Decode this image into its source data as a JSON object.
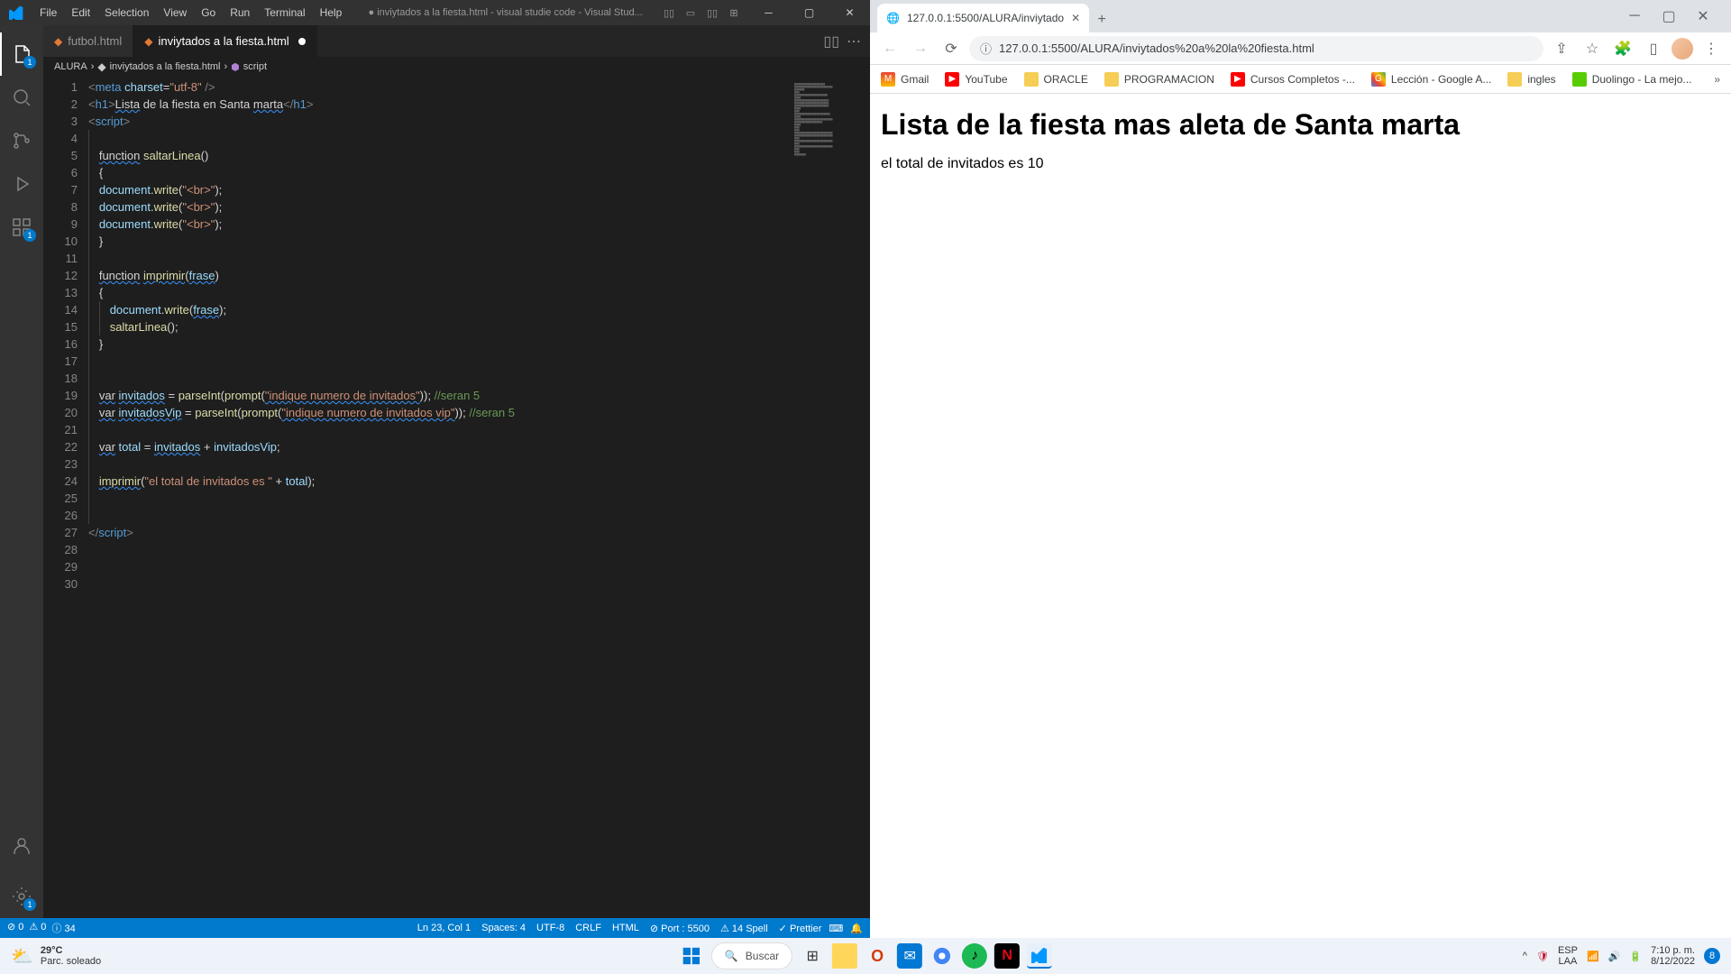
{
  "vscode": {
    "menus": [
      "File",
      "Edit",
      "Selection",
      "View",
      "Go",
      "Run",
      "Terminal",
      "Help"
    ],
    "title": "● inviytados a la fiesta.html - visual studie code - Visual Stud...",
    "tabs": [
      {
        "name": "futbol.html",
        "active": false,
        "dirty": false
      },
      {
        "name": "inviytados a la fiesta.html",
        "active": true,
        "dirty": true
      }
    ],
    "breadcrumb": {
      "folder": "ALURA",
      "file": "inviytados a la fiesta.html",
      "symbol": "script"
    },
    "lines": 30,
    "code": [
      {
        "n": 1,
        "t": [
          [
            "tag",
            "<"
          ],
          [
            "tagname",
            "meta"
          ],
          [
            "txt",
            " "
          ],
          [
            "attr",
            "charset"
          ],
          [
            "op",
            "="
          ],
          [
            "str",
            "\"utf-8\""
          ],
          [
            "txt",
            " "
          ],
          [
            "tag",
            "/>"
          ]
        ]
      },
      {
        "n": 2,
        "t": []
      },
      {
        "n": 3,
        "t": [
          [
            "tag",
            "<"
          ],
          [
            "tagname",
            "h1"
          ],
          [
            "tag",
            ">"
          ],
          [
            "txtw",
            "Lista"
          ],
          [
            "txt",
            " de la fiesta en Santa "
          ],
          [
            "txtw",
            "marta"
          ],
          [
            "tag",
            "</"
          ],
          [
            "tagname",
            "h1"
          ],
          [
            "tag",
            ">"
          ]
        ]
      },
      {
        "n": 4,
        "t": []
      },
      {
        "n": 5,
        "t": [
          [
            "tag",
            "<"
          ],
          [
            "tagname",
            "script"
          ],
          [
            "tag",
            ">"
          ]
        ]
      },
      {
        "n": 6,
        "t": [],
        "indent": 1
      },
      {
        "n": 7,
        "t": [
          [
            "kw",
            "function"
          ],
          [
            "txt",
            " "
          ],
          [
            "fn",
            "saltarLinea"
          ],
          [
            "punc",
            "()"
          ]
        ],
        "indent": 1
      },
      {
        "n": 8,
        "t": [
          [
            "punc",
            "{"
          ]
        ],
        "indent": 1
      },
      {
        "n": 9,
        "t": [
          [
            "var",
            "document"
          ],
          [
            "punc",
            "."
          ],
          [
            "fn",
            "write"
          ],
          [
            "punc",
            "("
          ],
          [
            "str",
            "\"<br>\""
          ],
          [
            "punc",
            ");"
          ]
        ],
        "indent": 1
      },
      {
        "n": 10,
        "t": [
          [
            "var",
            "document"
          ],
          [
            "punc",
            "."
          ],
          [
            "fn",
            "write"
          ],
          [
            "punc",
            "("
          ],
          [
            "str",
            "\"<br>\""
          ],
          [
            "punc",
            ");"
          ]
        ],
        "indent": 1
      },
      {
        "n": 11,
        "t": [
          [
            "var",
            "document"
          ],
          [
            "punc",
            "."
          ],
          [
            "fn",
            "write"
          ],
          [
            "punc",
            "("
          ],
          [
            "str",
            "\"<br>\""
          ],
          [
            "punc",
            ");"
          ]
        ],
        "indent": 1
      },
      {
        "n": 12,
        "t": [
          [
            "punc",
            "}"
          ]
        ],
        "indent": 1
      },
      {
        "n": 13,
        "t": [],
        "indent": 1
      },
      {
        "n": 14,
        "t": [
          [
            "kw",
            "function"
          ],
          [
            "txt",
            " "
          ],
          [
            "fnw",
            "imprimir"
          ],
          [
            "punc",
            "("
          ],
          [
            "varw",
            "frase"
          ],
          [
            "punc",
            ")"
          ]
        ],
        "indent": 1
      },
      {
        "n": 15,
        "t": [
          [
            "punc",
            "{"
          ]
        ],
        "indent": 1
      },
      {
        "n": 16,
        "t": [
          [
            "var",
            "document"
          ],
          [
            "punc",
            "."
          ],
          [
            "fn",
            "write"
          ],
          [
            "punc",
            "("
          ],
          [
            "varw",
            "frase"
          ],
          [
            "punc",
            ");"
          ]
        ],
        "indent": 2
      },
      {
        "n": 17,
        "t": [
          [
            "fn",
            "saltarLinea"
          ],
          [
            "punc",
            "();"
          ]
        ],
        "indent": 2
      },
      {
        "n": 18,
        "t": [
          [
            "punc",
            "}"
          ]
        ],
        "indent": 1
      },
      {
        "n": 19,
        "t": [],
        "indent": 1
      },
      {
        "n": 20,
        "t": [],
        "indent": 1
      },
      {
        "n": 21,
        "t": [
          [
            "kw",
            "var"
          ],
          [
            "txt",
            " "
          ],
          [
            "varw",
            "invitados"
          ],
          [
            "txt",
            " "
          ],
          [
            "op",
            "="
          ],
          [
            "txt",
            " "
          ],
          [
            "fn",
            "parseInt"
          ],
          [
            "punc",
            "("
          ],
          [
            "fn",
            "prompt"
          ],
          [
            "punc",
            "("
          ],
          [
            "strw",
            "\"indique numero de invitados\""
          ],
          [
            "punc",
            ")); "
          ],
          [
            "cm",
            "//seran 5"
          ]
        ],
        "indent": 1
      },
      {
        "n": 22,
        "t": [
          [
            "kw",
            "var"
          ],
          [
            "txt",
            " "
          ],
          [
            "varw",
            "invitadosVip"
          ],
          [
            "txt",
            " "
          ],
          [
            "op",
            "="
          ],
          [
            "txt",
            " "
          ],
          [
            "fn",
            "parseInt"
          ],
          [
            "punc",
            "("
          ],
          [
            "fn",
            "prompt"
          ],
          [
            "punc",
            "("
          ],
          [
            "strw",
            "\"indique numero de invitados vip\""
          ],
          [
            "punc",
            ")); "
          ],
          [
            "cm",
            "//seran 5"
          ]
        ],
        "indent": 1
      },
      {
        "n": 23,
        "t": [],
        "indent": 1,
        "cursor": true
      },
      {
        "n": 24,
        "t": [
          [
            "kw",
            "var"
          ],
          [
            "txt",
            " "
          ],
          [
            "var",
            "total"
          ],
          [
            "txt",
            " "
          ],
          [
            "op",
            "="
          ],
          [
            "txt",
            " "
          ],
          [
            "varw",
            "invitados"
          ],
          [
            "txt",
            " "
          ],
          [
            "op",
            "+"
          ],
          [
            "txt",
            " "
          ],
          [
            "var",
            "invitadosVip"
          ],
          [
            "punc",
            ";"
          ]
        ],
        "indent": 1
      },
      {
        "n": 25,
        "t": [],
        "indent": 1
      },
      {
        "n": 26,
        "t": [
          [
            "fnw",
            "imprimir"
          ],
          [
            "punc",
            "("
          ],
          [
            "str",
            "\"el total de invitados es \""
          ],
          [
            "txt",
            " "
          ],
          [
            "op",
            "+"
          ],
          [
            "txt",
            " "
          ],
          [
            "var",
            "total"
          ],
          [
            "punc",
            ");"
          ]
        ],
        "indent": 1
      },
      {
        "n": 27,
        "t": [],
        "indent": 1
      },
      {
        "n": 28,
        "t": [],
        "indent": 1
      },
      {
        "n": 29,
        "t": [
          [
            "tag",
            "</"
          ],
          [
            "tagname",
            "script"
          ],
          [
            "tag",
            ">"
          ]
        ]
      },
      {
        "n": 30,
        "t": []
      }
    ],
    "status": {
      "left": [
        {
          "icon": "⊘",
          "text": "0"
        },
        {
          "icon": "⚠",
          "text": "0"
        },
        {
          "icon": "ⓘ",
          "text": "34"
        }
      ],
      "right": [
        "Ln 23, Col 1",
        "Spaces: 4",
        "UTF-8",
        "CRLF",
        "HTML",
        "⊘ Port : 5500",
        "⚠ 14 Spell",
        "✓ Prettier"
      ]
    },
    "activity_badge": "1"
  },
  "chrome": {
    "tab": {
      "title": "127.0.0.1:5500/ALURA/inviytado"
    },
    "url": "127.0.0.1:5500/ALURA/inviytados%20a%20la%20fiesta.html",
    "bookmarks": [
      {
        "label": "Gmail",
        "style": "bm-gmail",
        "icon": "M"
      },
      {
        "label": "YouTube",
        "style": "bm-yt",
        "icon": "▶"
      },
      {
        "label": "ORACLE",
        "style": "bm-folder",
        "icon": ""
      },
      {
        "label": "PROGRAMACION",
        "style": "bm-folder",
        "icon": ""
      },
      {
        "label": "Cursos Completos -...",
        "style": "bm-yt",
        "icon": "▶"
      },
      {
        "label": "Lección - Google A...",
        "style": "bm-google",
        "icon": "G"
      },
      {
        "label": "ingles",
        "style": "bm-folder",
        "icon": ""
      },
      {
        "label": "Duolingo - La mejo...",
        "style": "bm-duo",
        "icon": ""
      }
    ],
    "page": {
      "h1": "Lista de la fiesta mas aleta de Santa marta",
      "text": "el total de invitados es 10"
    }
  },
  "taskbar": {
    "weather": {
      "temp": "29°C",
      "desc": "Parc. soleado"
    },
    "search": "Buscar",
    "lang": {
      "code": "ESP",
      "region": "LAA"
    },
    "clock": {
      "time": "7:10 p. m.",
      "date": "8/12/2022"
    },
    "notif": "8"
  }
}
